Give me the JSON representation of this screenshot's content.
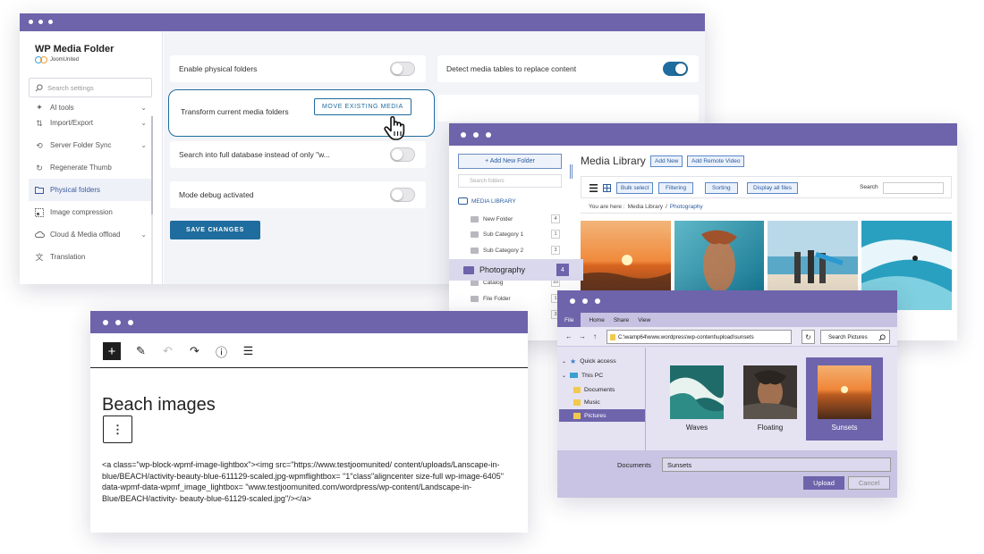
{
  "settings": {
    "brand_title": "WP Media Folder",
    "brand_sub": "JoomUnited",
    "search_placeholder": "Search settings",
    "menu": [
      {
        "label": "AI tools",
        "icon": "ai-tools-icon"
      },
      {
        "label": "Import/Export",
        "icon": "import-export-icon"
      },
      {
        "label": "Server Folder Sync",
        "icon": "sync-icon"
      },
      {
        "label": "Regenerate Thumb",
        "icon": "regenerate-icon"
      },
      {
        "label": "Physical folders",
        "icon": "folder-icon",
        "active": true
      },
      {
        "label": "Image compression",
        "icon": "compression-icon"
      },
      {
        "label": "Cloud & Media offload",
        "icon": "cloud-icon"
      },
      {
        "label": "Translation",
        "icon": "translation-icon"
      }
    ],
    "options": {
      "enable_physical": "Enable physical folders",
      "detect_tables": "Detect media tables to replace content",
      "transform": "Transform current media folders",
      "move_button": "MOVE EXISTING MEDIA",
      "search_full": "Search into full database instead of only \"w...",
      "debug": "Mode debug activated"
    },
    "toggles": {
      "enable_physical": false,
      "detect_tables": true,
      "search_full": false,
      "debug": false
    },
    "save_button": "SAVE CHANGES",
    "accent_color": "#1f6c9e"
  },
  "media_library": {
    "add_folder": "+ Add New Folder",
    "search_folders": "Search folders",
    "root": "MEDIA LIBRARY",
    "folders": [
      {
        "name": "New Folder",
        "count": "4"
      },
      {
        "name": "Sub Category 1",
        "count": "1"
      },
      {
        "name": "Sub Category 2",
        "count": "3"
      },
      {
        "name": "Photography",
        "count": "4",
        "selected": true
      },
      {
        "name": "Catalog",
        "count": "10"
      },
      {
        "name": "File Folder",
        "count": "1"
      },
      {
        "name": "",
        "count": "3"
      }
    ],
    "title": "Media Library",
    "add_new": "Add New",
    "add_remote": "Add Remote Video",
    "bulk_select": "Bulk select",
    "filtering": "Filtering",
    "sorting": "Sorting",
    "display_all": "Display all files",
    "search_label": "Search",
    "you_are_here": "You are here :",
    "crumb_root": "Media Library",
    "crumb_sep": "/",
    "crumb_current": "Photography"
  },
  "editor": {
    "title": "Beach images",
    "more": "⋮",
    "code": "<a class=\"wp-block-wpmf-image-lightbox\"><img src=\"https://www.testjoomunited/ content/uploads/Lanscape-in-blue/BEACH/activity-beauty-blue-611129-scaled.jpg-wpmflightbox= \"1\"class\"aligncenter size-full wp-image-6405\" data-wpmf-data-wpmf_image_lightbox= \"www.testjoomunited.com/wordpress/wp-content/Landscape-in-Blue/BEACH/activity- beauty-blue-61129-scaled.jpg\"/></a>"
  },
  "explorer": {
    "ribbon": [
      "File",
      "Home",
      "Share",
      "View"
    ],
    "address": "C:\\wamp64\\www.wordpress\\wp-content\\upload\\sunsets",
    "search": "Search Pictures",
    "tree": [
      {
        "label": "Quick access"
      },
      {
        "label": "This PC"
      },
      {
        "label": "Documents"
      },
      {
        "label": "Music"
      },
      {
        "label": "Pictures",
        "selected": true
      }
    ],
    "files": [
      {
        "name": "Waves"
      },
      {
        "name": "Floating"
      },
      {
        "name": "Sunsets",
        "selected": true
      }
    ],
    "docs_label": "Documents",
    "filename": "Sunsets",
    "upload": "Upload",
    "cancel": "Cancel",
    "accent_color": "#6e64ab"
  }
}
